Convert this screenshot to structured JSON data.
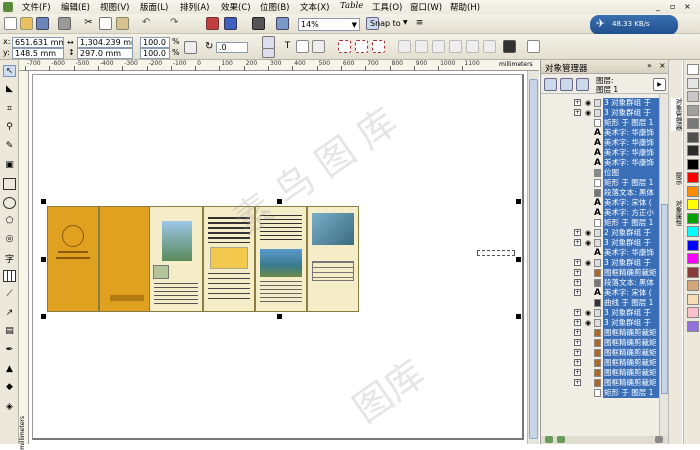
{
  "menu": [
    "文件(F)",
    "编辑(E)",
    "视图(V)",
    "版面(L)",
    "排列(A)",
    "效果(C)",
    "位图(B)",
    "文本(X)",
    "Table",
    "工具(O)",
    "窗口(W)",
    "帮助(H)"
  ],
  "toolbar": {
    "zoom": "14%",
    "snap_to": "Snap to",
    "network_speed": "48.33 KB/s"
  },
  "propbar": {
    "x": "651.631 mm",
    "y": "148.5 mm",
    "width": "1,304.239 mm",
    "height": "297.0 mm",
    "scale_x": "100.0",
    "scale_y": "100.0",
    "percent": "%",
    "rotation": ".0",
    "x_label": "x:",
    "y_label": "y:"
  },
  "ruler": {
    "ticks": [
      "-700",
      "-600",
      "-500",
      "-400",
      "-300",
      "-200",
      "-100",
      "0",
      "100",
      "200",
      "300",
      "400",
      "500",
      "600",
      "700",
      "800",
      "900",
      "1000",
      "1100"
    ],
    "unit": "millimeters",
    "vertical_unit": "millimeters"
  },
  "docker": {
    "title": "对象管理器",
    "layer_line1": "图层:",
    "layer_line2": "图层 1",
    "rows": [
      {
        "text": "3 对象群组 于",
        "expand": true,
        "kind": "group"
      },
      {
        "text": "3 对象群组 于",
        "expand": true,
        "kind": "group"
      },
      {
        "text": "矩形 于 图层 1",
        "expand": false,
        "kind": "rect"
      },
      {
        "text": "美术字: 华康饰",
        "expand": false,
        "kind": "art"
      },
      {
        "text": "美术字: 华康饰",
        "expand": false,
        "kind": "art"
      },
      {
        "text": "美术字: 华康饰",
        "expand": false,
        "kind": "art"
      },
      {
        "text": "美术字: 华康饰",
        "expand": false,
        "kind": "art"
      },
      {
        "text": "位图",
        "expand": false,
        "kind": "bmp"
      },
      {
        "text": "矩形 于 图层 1",
        "expand": false,
        "kind": "rect"
      },
      {
        "text": "段落文本: 黑体",
        "expand": false,
        "kind": "para"
      },
      {
        "text": "美术字: 宋体 (",
        "expand": false,
        "kind": "art"
      },
      {
        "text": "美术字: 方正小",
        "expand": false,
        "kind": "art"
      },
      {
        "text": "矩形 于 图层 1",
        "expand": false,
        "kind": "rect"
      },
      {
        "text": "2 对象群组 于",
        "expand": true,
        "kind": "group"
      },
      {
        "text": "3 对象群组 于",
        "expand": true,
        "kind": "group"
      },
      {
        "text": "美术字: 华康饰",
        "expand": false,
        "kind": "art"
      },
      {
        "text": "3 对象群组 于",
        "expand": true,
        "kind": "group"
      },
      {
        "text": "图框精确剪裁矩",
        "expand": true,
        "kind": "clip"
      },
      {
        "text": "段落文本: 黑体",
        "expand": true,
        "kind": "para"
      },
      {
        "text": "美术字: 宋体 (",
        "expand": true,
        "kind": "art"
      },
      {
        "text": "曲线 于 图层 1",
        "expand": false,
        "kind": "curve"
      },
      {
        "text": "3 对象群组 于",
        "expand": true,
        "kind": "group"
      },
      {
        "text": "3 对象群组 于",
        "expand": true,
        "kind": "group"
      },
      {
        "text": "图框精确剪裁矩",
        "expand": true,
        "kind": "clip"
      },
      {
        "text": "图框精确剪裁矩",
        "expand": true,
        "kind": "clip"
      },
      {
        "text": "图框精确剪裁矩",
        "expand": true,
        "kind": "clip"
      },
      {
        "text": "图框精确剪裁矩",
        "expand": true,
        "kind": "clip"
      },
      {
        "text": "图框精确剪裁矩",
        "expand": true,
        "kind": "clip"
      },
      {
        "text": "图框精确剪裁矩",
        "expand": true,
        "kind": "clip"
      },
      {
        "text": "矩形 于 图层 1",
        "expand": false,
        "kind": "rect"
      }
    ]
  },
  "sidetabs": [
    "对象管理器",
    "提示",
    "对象属性"
  ],
  "palette": [
    "#ffffff",
    "#e6e6e6",
    "#c8c8c8",
    "#a0a0a0",
    "#787878",
    "#505050",
    "#2a2a2a",
    "#000000",
    "#ff0000",
    "#ff8c00",
    "#ffff00",
    "#00a000",
    "#00ffff",
    "#0000ff",
    "#ff00ff",
    "#8b3a3a",
    "#d2a679",
    "#f5deb3",
    "#ffc0cb",
    "#9370db"
  ],
  "watermark": [
    "素 鸟 图 库",
    "图库"
  ],
  "colors": {
    "accent": "#3a6fb8",
    "brochure": "#e0a020",
    "panel_bg": "#f5ecc8"
  }
}
